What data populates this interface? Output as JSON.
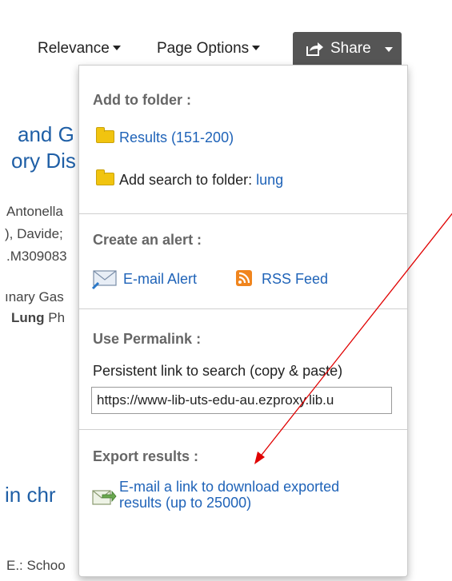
{
  "toolbar": {
    "relevance_label": "Relevance",
    "page_options_label": "Page Options",
    "share_label": "Share"
  },
  "background": {
    "title_line1": "and G",
    "title_line2": "ory Dis",
    "meta_line1": "Antonella",
    "meta_line2": "), Davide;",
    "meta_line3": ".M309083",
    "meta_line4": "ınary Gas",
    "meta_line5_bold": "Lung",
    "meta_line5_rest": " Ph",
    "title2": "in chr",
    "footer_meta": "E.: Schoo"
  },
  "dropdown": {
    "add_to_folder": {
      "heading": "Add to folder :",
      "results_link": "Results (151-200)",
      "add_search_text": "Add search to folder: ",
      "search_term": "lung"
    },
    "alert": {
      "heading": "Create an alert :",
      "email_alert": "E-mail Alert",
      "rss_feed": "RSS Feed"
    },
    "permalink": {
      "heading": "Use Permalink :",
      "description": "Persistent link to search (copy & paste)",
      "url": "https://www-lib-uts-edu-au.ezproxy.lib.u"
    },
    "export": {
      "heading": "Export results :",
      "link_line1": "E-mail a link to download exported",
      "link_line2": "results (up to 25000)"
    }
  },
  "colors": {
    "link": "#1f63b8",
    "share_button": "#555555",
    "rss": "#f0851e",
    "annotation_arrow": "#e00000"
  }
}
